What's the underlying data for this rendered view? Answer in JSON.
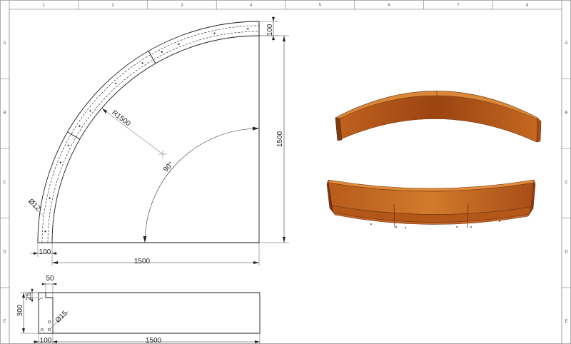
{
  "colors": {
    "line": "#1a1a1a",
    "border": "#9a9a9a",
    "steel_dark": "#8e3d0f",
    "steel_mid": "#b65a1b",
    "steel_light": "#d07428"
  },
  "zones": {
    "columns": [
      "1",
      "2",
      "3",
      "4",
      "5",
      "6",
      "7",
      "8"
    ],
    "rows": [
      "A",
      "B",
      "C",
      "D",
      "E"
    ]
  },
  "dimensions": {
    "top_thickness": "100",
    "height_right": "1500",
    "radius": "R1500",
    "angle": "90°",
    "hole_diameter_plan": "Ø12",
    "bottom_thickness": "100",
    "width_plan": "1500",
    "flange_width": "50",
    "flange_height": "25",
    "side_height": "300",
    "hole_diameter_side": "Ø15",
    "bottom_thickness_side": "100",
    "length_side": "1500"
  }
}
